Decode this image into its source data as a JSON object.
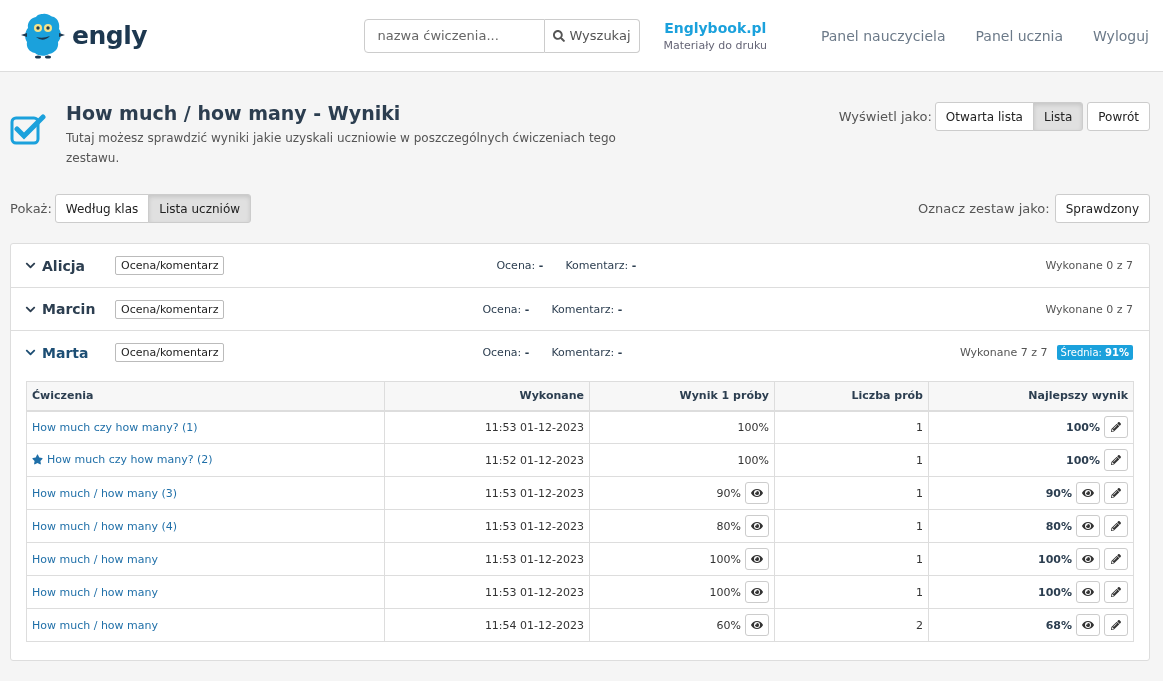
{
  "header": {
    "logo_text": "engly",
    "search": {
      "placeholder": "nazwa ćwiczenia...",
      "button": "Wyszukaj"
    },
    "brand_link": {
      "title": "Englybook.pl",
      "subtitle": "Materiały do druku"
    },
    "nav": [
      "Panel nauczyciela",
      "Panel ucznia",
      "Wyloguj"
    ]
  },
  "page": {
    "title": "How much / how many - Wyniki",
    "description": "Tutaj możesz sprawdzić wyniki jakie uzyskali uczniowie w poszczególnych ćwiczeniach tego zestawu.",
    "view_label": "Wyświetl jako:",
    "view_options": [
      {
        "label": "Otwarta lista",
        "selected": false
      },
      {
        "label": "Lista",
        "selected": true
      }
    ],
    "back_button": "Powrót",
    "show_label": "Pokaż:",
    "show_options": [
      {
        "label": "Według klas",
        "selected": false
      },
      {
        "label": "Lista uczniów",
        "selected": true
      }
    ],
    "mark_label": "Oznacz zestaw jako:",
    "mark_button": "Sprawdzony"
  },
  "students": [
    {
      "name": "Alicja",
      "expanded": false,
      "grade_button": "Ocena/komentarz",
      "grade_label": "Ocena:",
      "grade_value": "-",
      "comment_label": "Komentarz:",
      "comment_value": "-",
      "done": "Wykonane 0 z 7"
    },
    {
      "name": "Marcin",
      "expanded": false,
      "grade_button": "Ocena/komentarz",
      "grade_label": "Ocena:",
      "grade_value": "-",
      "comment_label": "Komentarz:",
      "comment_value": "-",
      "done": "Wykonane 0 z 7"
    },
    {
      "name": "Marta",
      "expanded": true,
      "grade_button": "Ocena/komentarz",
      "grade_label": "Ocena:",
      "grade_value": "-",
      "comment_label": "Komentarz:",
      "comment_value": "-",
      "done": "Wykonane 7 z 7",
      "average": "Średnia: **91%**",
      "table": {
        "columns": [
          "Ćwiczenia",
          "Wykonane",
          "Wynik 1 próby",
          "Liczba prób",
          "Najlepszy wynik"
        ],
        "rows": [
          {
            "exercise": "How much czy how many? (1)",
            "starred": false,
            "done": "11:53 01-12-2023",
            "first_score": "100%",
            "first_view": false,
            "attempts": "1",
            "best": "100%",
            "best_view": false
          },
          {
            "exercise": "How much czy how many? (2)",
            "starred": true,
            "done": "11:52 01-12-2023",
            "first_score": "100%",
            "first_view": false,
            "attempts": "1",
            "best": "100%",
            "best_view": false
          },
          {
            "exercise": "How much / how many (3)",
            "starred": false,
            "done": "11:53 01-12-2023",
            "first_score": "90%",
            "first_view": true,
            "attempts": "1",
            "best": "90%",
            "best_view": true
          },
          {
            "exercise": "How much / how many (4)",
            "starred": false,
            "done": "11:53 01-12-2023",
            "first_score": "80%",
            "first_view": true,
            "attempts": "1",
            "best": "80%",
            "best_view": true
          },
          {
            "exercise": "How much / how many",
            "starred": false,
            "done": "11:53 01-12-2023",
            "first_score": "100%",
            "first_view": true,
            "attempts": "1",
            "best": "100%",
            "best_view": true
          },
          {
            "exercise": "How much / how many",
            "starred": false,
            "done": "11:53 01-12-2023",
            "first_score": "100%",
            "first_view": true,
            "attempts": "1",
            "best": "100%",
            "best_view": true
          },
          {
            "exercise": "How much / how many",
            "starred": false,
            "done": "11:54 01-12-2023",
            "first_score": "60%",
            "first_view": true,
            "attempts": "2",
            "best": "68%",
            "best_view": true
          }
        ]
      }
    }
  ]
}
